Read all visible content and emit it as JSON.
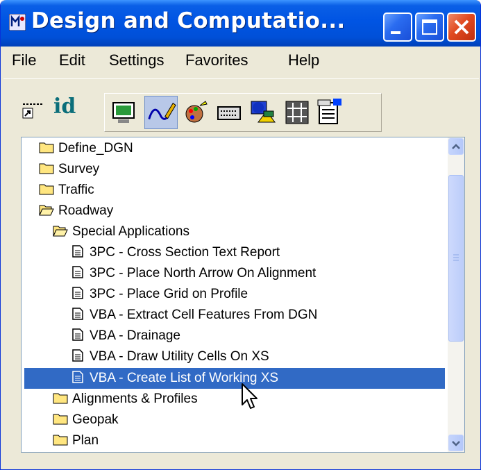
{
  "window": {
    "title": "Design and Computatio..."
  },
  "menu": [
    {
      "label": "File"
    },
    {
      "label": "Edit"
    },
    {
      "label": "Settings"
    },
    {
      "label": "Favorites"
    },
    {
      "label": "Help"
    }
  ],
  "toolbar": {
    "id_label": "id"
  },
  "tree": {
    "items": [
      {
        "label": "Define_DGN",
        "icon": "folder-closed-icon"
      },
      {
        "label": "Survey",
        "icon": "folder-closed-icon"
      },
      {
        "label": "Traffic",
        "icon": "folder-closed-icon"
      },
      {
        "label": "Roadway",
        "icon": "folder-open-icon"
      },
      {
        "label": "Special Applications",
        "icon": "folder-open-icon"
      },
      {
        "label": "3PC - Cross Section Text Report",
        "icon": "document-icon"
      },
      {
        "label": "3PC -  Place North Arrow On Alignment",
        "icon": "document-icon"
      },
      {
        "label": "3PC -  Place Grid on Profile",
        "icon": "document-icon"
      },
      {
        "label": "VBA -  Extract Cell Features From DGN",
        "icon": "document-icon"
      },
      {
        "label": "VBA -  Drainage",
        "icon": "document-icon"
      },
      {
        "label": "VBA -  Draw Utility Cells On XS",
        "icon": "document-icon"
      },
      {
        "label": "VBA -  Create List of Working XS",
        "icon": "document-icon",
        "selected": true
      },
      {
        "label": "Alignments & Profiles",
        "icon": "folder-closed-icon"
      },
      {
        "label": "Geopak",
        "icon": "folder-closed-icon"
      },
      {
        "label": "Plan",
        "icon": "folder-closed-icon"
      }
    ]
  },
  "colors": {
    "selection": "#316ac5",
    "titlebar": "#0054e3",
    "frame": "#ece9d8"
  }
}
